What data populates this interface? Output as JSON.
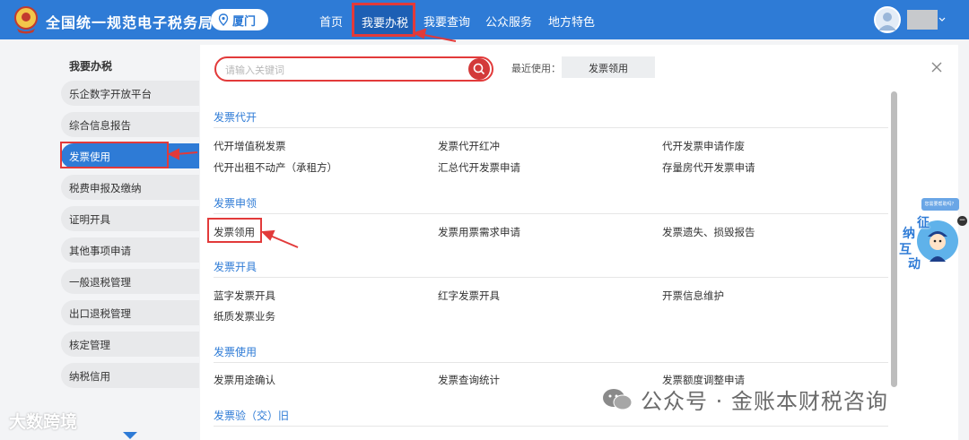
{
  "header": {
    "site_title": "全国统一规范电子税务局",
    "city": "厦门",
    "nav": [
      "首页",
      "我要办税",
      "我要查询",
      "公众服务",
      "地方特色"
    ],
    "active_nav": "我要办税"
  },
  "sidebar": {
    "title": "我要办税",
    "items": [
      {
        "label": "乐企数字开放平台"
      },
      {
        "label": "综合信息报告"
      },
      {
        "label": "发票使用",
        "active": true
      },
      {
        "label": "税费申报及缴纳"
      },
      {
        "label": "证明开具"
      },
      {
        "label": "其他事项申请"
      },
      {
        "label": "一般退税管理"
      },
      {
        "label": "出口退税管理"
      },
      {
        "label": "核定管理"
      },
      {
        "label": "纳税信用"
      }
    ]
  },
  "search": {
    "placeholder": "请输入关键词",
    "recent_label": "最近使用：",
    "recent_item": "发票领用"
  },
  "sections": [
    {
      "title": "发票代开",
      "rows": [
        [
          "代开增值税发票",
          "发票代开红冲",
          "代开发票申请作废"
        ],
        [
          "代开出租不动产（承租方）",
          "汇总代开发票申请",
          "存量房代开发票申请"
        ]
      ]
    },
    {
      "title": "发票申领",
      "rows": [
        [
          "发票领用",
          "发票用票需求申请",
          "发票遗失、损毁报告"
        ]
      ]
    },
    {
      "title": "发票开具",
      "rows": [
        [
          "蓝字发票开具",
          "红字发票开具",
          "开票信息维护"
        ],
        [
          "纸质发票业务"
        ]
      ]
    },
    {
      "title": "发票使用",
      "rows": [
        [
          "发票用途确认",
          "发票查询统计",
          "发票额度调整申请"
        ]
      ]
    },
    {
      "title": "发票验（交）旧",
      "rows": []
    }
  ],
  "float_widget": {
    "bubble": "您需要帮助吗？",
    "chars": [
      "征",
      "纳",
      "互",
      "动"
    ]
  },
  "watermarks": {
    "left": "大数跨境",
    "right": "公众号 · 金账本财税咨询"
  },
  "colors": {
    "header_blue": "#2e7bd6",
    "highlight_red": "#e23a3a",
    "link_blue": "#2e7bd6"
  }
}
